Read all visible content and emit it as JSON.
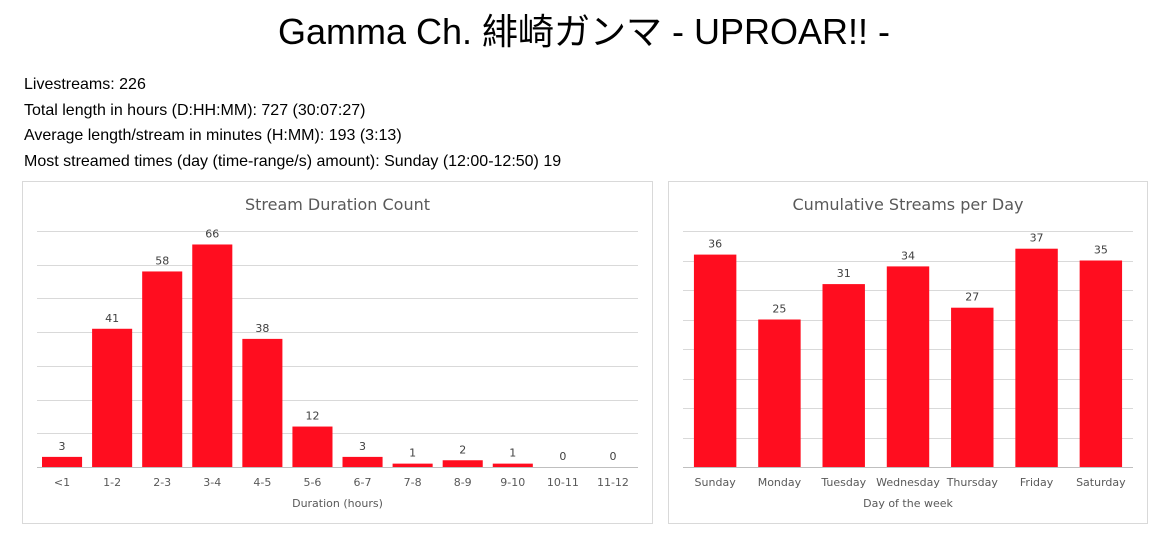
{
  "page": {
    "title": "Gamma Ch. 緋崎ガンマ - UPROAR!! -"
  },
  "stats": [
    "Livestreams: 226",
    "Total length in hours (D:HH:MM): 727 (30:07:27)",
    "Average length/stream in minutes (H:MM): 193 (3:13)",
    "Most streamed times (day (time-range/s) amount): Sunday (12:00-12:50) 19"
  ],
  "chart_data": [
    {
      "type": "bar",
      "title": "Stream Duration Count",
      "xlabel": "Duration (hours)",
      "ylabel": "",
      "categories": [
        "<1",
        "1-2",
        "2-3",
        "3-4",
        "4-5",
        "5-6",
        "6-7",
        "7-8",
        "8-9",
        "9-10",
        "10-11",
        "11-12"
      ],
      "values": [
        3,
        41,
        58,
        66,
        38,
        12,
        3,
        1,
        2,
        1,
        0,
        0
      ],
      "ylim": [
        0,
        70
      ],
      "gridline_step": 10,
      "grid": true,
      "data_labels": true,
      "color": "#ff0d1f"
    },
    {
      "type": "bar",
      "title": "Cumulative Streams per Day",
      "xlabel": "Day of the week",
      "ylabel": "",
      "categories": [
        "Sunday",
        "Monday",
        "Tuesday",
        "Wednesday",
        "Thursday",
        "Friday",
        "Saturday"
      ],
      "values": [
        36,
        25,
        31,
        34,
        27,
        37,
        35
      ],
      "ylim": [
        0,
        40
      ],
      "gridline_step": 5,
      "grid": true,
      "data_labels": true,
      "color": "#ff0d1f"
    }
  ]
}
